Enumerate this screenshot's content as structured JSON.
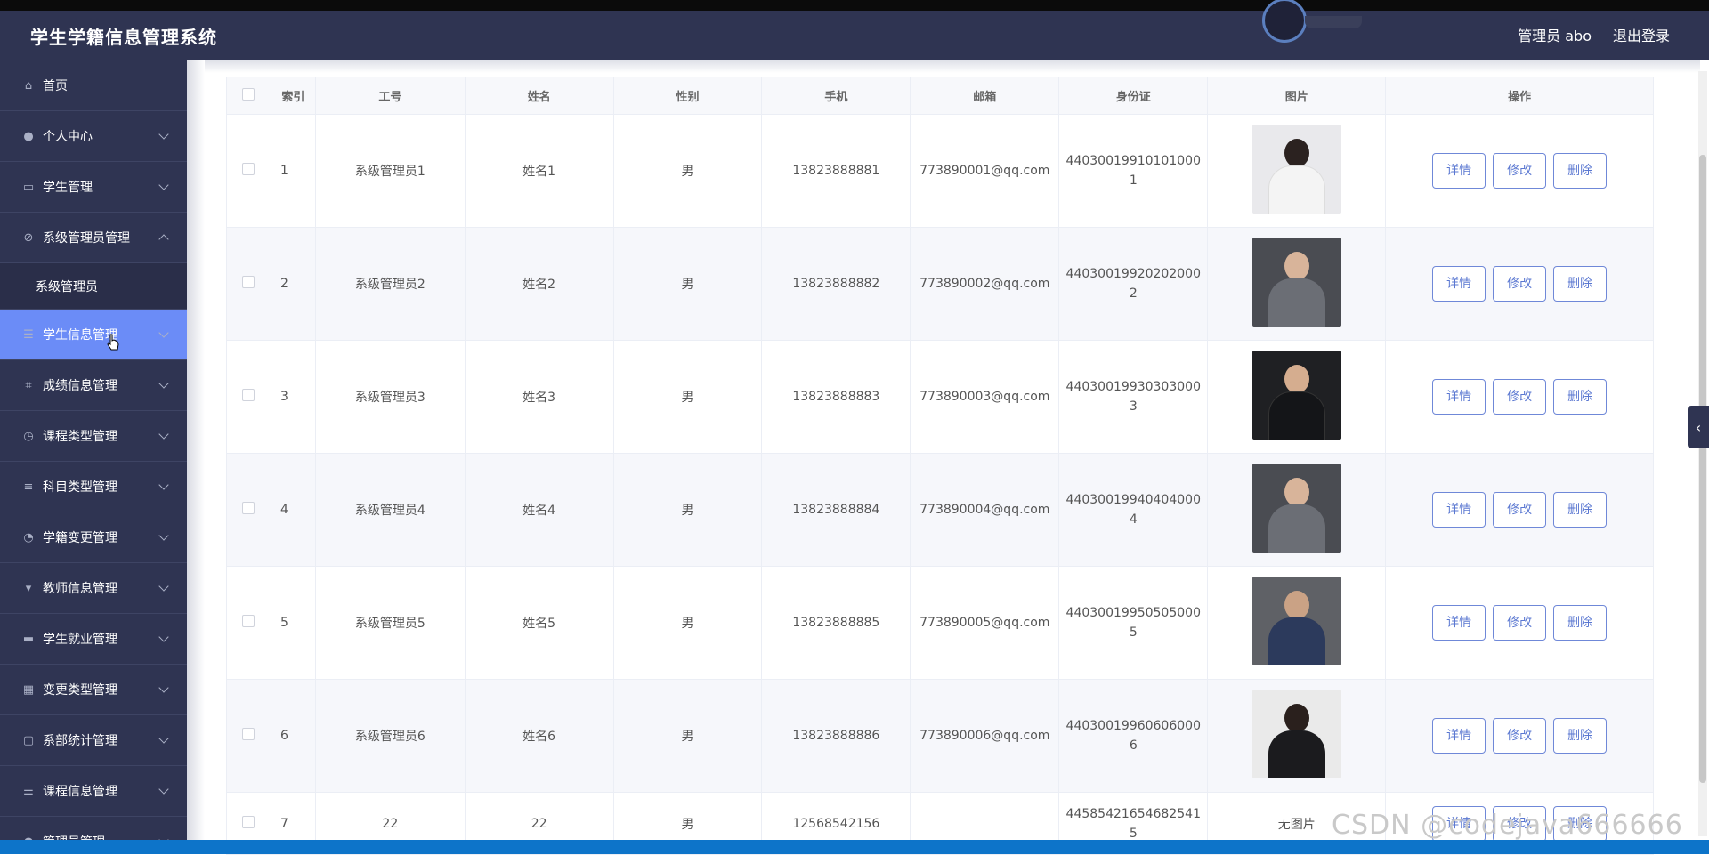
{
  "app": {
    "title": "学生学籍信息管理系统"
  },
  "header": {
    "user_label": "管理员 abo",
    "logout_label": "退出登录"
  },
  "sidebar": {
    "items": [
      {
        "label": "首页",
        "icon": "home-icon",
        "expandable": false
      },
      {
        "label": "个人中心",
        "icon": "user-icon",
        "expandable": true
      },
      {
        "label": "学生管理",
        "icon": "idcard-icon",
        "expandable": true
      },
      {
        "label": "系级管理员管理",
        "icon": "mute-icon",
        "expandable": true,
        "expanded": true
      },
      {
        "label": "学生信息管理",
        "icon": "list-icon",
        "expandable": true,
        "active": true
      },
      {
        "label": "成绩信息管理",
        "icon": "crop-icon",
        "expandable": true
      },
      {
        "label": "课程类型管理",
        "icon": "clock-icon",
        "expandable": true
      },
      {
        "label": "科目类型管理",
        "icon": "menu-icon",
        "expandable": true
      },
      {
        "label": "学籍变更管理",
        "icon": "speed-icon",
        "expandable": true
      },
      {
        "label": "教师信息管理",
        "icon": "podium-icon",
        "expandable": true
      },
      {
        "label": "学生就业管理",
        "icon": "monitor-icon",
        "expandable": true
      },
      {
        "label": "变更类型管理",
        "icon": "grid-icon",
        "expandable": true
      },
      {
        "label": "系部统计管理",
        "icon": "chat-icon",
        "expandable": true
      },
      {
        "label": "课程信息管理",
        "icon": "sliders-icon",
        "expandable": true
      },
      {
        "label": "管理员管理",
        "icon": "user-icon",
        "expandable": true
      }
    ],
    "submenu": {
      "parent": "系级管理员管理",
      "label": "系级管理员"
    }
  },
  "table": {
    "headers": [
      "",
      "索引",
      "工号",
      "姓名",
      "性别",
      "手机",
      "邮箱",
      "身份证",
      "图片",
      "操作"
    ],
    "rows": [
      {
        "index": "1",
        "job_no": "系级管理员1",
        "name": "姓名1",
        "gender": "男",
        "phone": "13823888881",
        "email": "773890001@qq.com",
        "id_line1": "44030019910101000",
        "id_line2": "1",
        "photo": "female-white"
      },
      {
        "index": "2",
        "job_no": "系级管理员2",
        "name": "姓名2",
        "gender": "男",
        "phone": "13823888882",
        "email": "773890002@qq.com",
        "id_line1": "44030019920202000",
        "id_line2": "2",
        "photo": "male-grey"
      },
      {
        "index": "3",
        "job_no": "系级管理员3",
        "name": "姓名3",
        "gender": "男",
        "phone": "13823888883",
        "email": "773890003@qq.com",
        "id_line1": "44030019930303000",
        "id_line2": "3",
        "photo": "male-dark"
      },
      {
        "index": "4",
        "job_no": "系级管理员4",
        "name": "姓名4",
        "gender": "男",
        "phone": "13823888884",
        "email": "773890004@qq.com",
        "id_line1": "44030019940404000",
        "id_line2": "4",
        "photo": "male-grey"
      },
      {
        "index": "5",
        "job_no": "系级管理员5",
        "name": "姓名5",
        "gender": "男",
        "phone": "13823888885",
        "email": "773890005@qq.com",
        "id_line1": "44030019950505000",
        "id_line2": "5",
        "photo": "male-seated"
      },
      {
        "index": "6",
        "job_no": "系级管理员6",
        "name": "姓名6",
        "gender": "男",
        "phone": "13823888886",
        "email": "773890006@qq.com",
        "id_line1": "44030019960606000",
        "id_line2": "6",
        "photo": "female-black"
      },
      {
        "index": "7",
        "job_no": "22",
        "name": "22",
        "gender": "男",
        "phone": "12568542156",
        "email": "",
        "id_line1": "44585421654682541",
        "id_line2": "5",
        "photo_text": "无图片"
      }
    ],
    "actions": {
      "detail": "详情",
      "edit": "修改",
      "delete": "删除"
    }
  },
  "watermark": "CSDN @codejava666666",
  "colors": {
    "header_bg": "#2f3452",
    "active_item": "#6b8cf7",
    "button_border": "#6f88d8"
  }
}
